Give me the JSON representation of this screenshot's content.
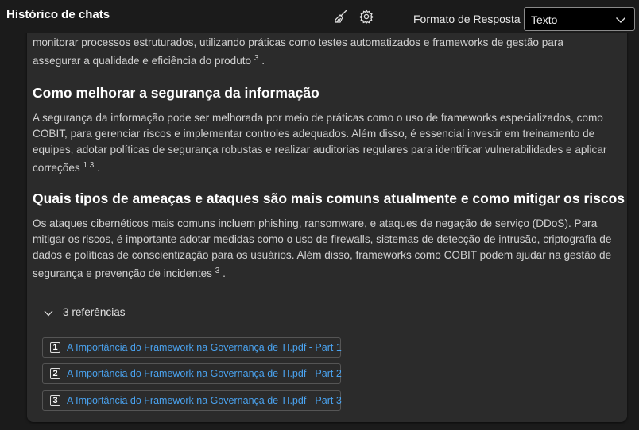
{
  "header": {
    "title": "Histórico de chats",
    "broom_icon": "broom-icon",
    "settings_icon": "gear-icon",
    "separator": "|",
    "format_label": "Formato de Resposta",
    "format_value": "Texto"
  },
  "content": {
    "intro_line1": "monitorar processos estruturados, utilizando práticas como testes automatizados e frameworks de gestão para",
    "intro_line2": "assegurar a qualidade e eficiência do produto",
    "intro_ref": "3",
    "section1": {
      "heading": "Como melhorar a segurança da informação",
      "text": "A segurança da informação pode ser melhorada por meio de práticas como o uso de frameworks especializados, como COBIT, para gerenciar riscos e implementar controles adequados. Além disso, é essencial investir em treinamento de equipes, adotar políticas de segurança robustas e realizar auditorias regulares para identificar vulnerabilidades e aplicar correções",
      "refs": "1 3"
    },
    "section2": {
      "heading": "Quais tipos de ameaças e ataques são mais comuns atualmente e como mitigar os riscos",
      "text": "Os ataques cibernéticos mais comuns incluem phishing, ransomware, e ataques de negação de serviço (DDoS). Para mitigar os riscos, é importante adotar medidas como o uso de firewalls, sistemas de detecção de intrusão, criptografia de dados e políticas de conscientização para os usuários. Além disso, frameworks como COBIT podem ajudar na gestão de segurança e prevenção de incidentes",
      "refs": "3"
    }
  },
  "references": {
    "toggle_label": "3 referências",
    "items": [
      {
        "num": "1",
        "title": "A Importância do Framework na Governança de TI.pdf - Part 1"
      },
      {
        "num": "2",
        "title": "A Importância do Framework na Governança de TI.pdf - Part 2"
      },
      {
        "num": "3",
        "title": "A Importância do Framework na Governança de TI.pdf - Part 3"
      }
    ]
  },
  "colors": {
    "background": "#1b1b1b",
    "card": "#2b2b2b",
    "link": "#4aa3f0"
  }
}
